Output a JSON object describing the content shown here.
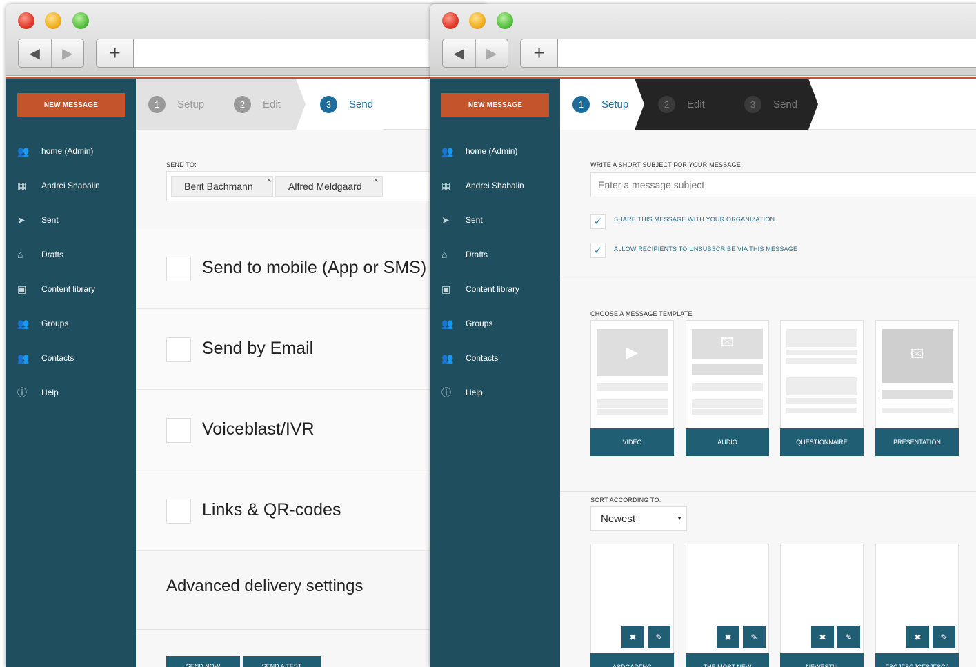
{
  "colors": {
    "sidebar_bg": "#1f4e5e",
    "accent_orange": "#c4542c",
    "primary_button": "#1f5e73",
    "active_step": "#1d6c9a",
    "inactive_step": "#9a9a9a",
    "dark_step_bar": "#242424"
  },
  "browser": {
    "back_icon": "back-arrow-icon",
    "forward_icon": "forward-arrow-icon",
    "new_tab_label": "+"
  },
  "sidebar": {
    "new_message_label": "NEW MESSAGE",
    "items": [
      {
        "label": "home (Admin)",
        "icon": "people-icon"
      },
      {
        "label": "Andrei Shabalin",
        "icon": "calendar-icon"
      },
      {
        "label": "Sent",
        "icon": "paper-plane-icon"
      },
      {
        "label": "Drafts",
        "icon": "inbox-icon"
      },
      {
        "label": "Content library",
        "icon": "library-icon"
      },
      {
        "label": "Groups",
        "icon": "people-icon"
      },
      {
        "label": "Contacts",
        "icon": "people-icon"
      },
      {
        "label": "Help",
        "icon": "info-icon"
      }
    ]
  },
  "steps": [
    {
      "num": "1",
      "label": "Setup"
    },
    {
      "num": "2",
      "label": "Edit"
    },
    {
      "num": "3",
      "label": "Send"
    }
  ],
  "send_page": {
    "active_step": "3",
    "send_to_label": "SEND TO:",
    "recipients": [
      "Berit Bachmann",
      "Alfred Meldgaard"
    ],
    "remove_icon_glyph": "×",
    "delivery_options": [
      "Send to mobile (App or SMS)",
      "Send by Email",
      "Voiceblast/IVR",
      "Links & QR-codes"
    ],
    "advanced_label": "Advanced delivery settings",
    "send_now_label": "SEND NOW",
    "send_test_label": "SEND A TEST"
  },
  "setup_page": {
    "active_step": "1",
    "subject_label": "WRITE A SHORT SUBJECT FOR YOUR MESSAGE",
    "subject_placeholder": "Enter a message subject",
    "share_label": "SHARE THIS MESSAGE WITH YOUR ORGANIZATION",
    "share_checked": true,
    "unsubscribe_label": "ALLOW RECIPIENTS TO UNSUBSCRIBE VIA THIS MESSAGE",
    "unsubscribe_checked": true,
    "check_glyph": "✓",
    "template_label": "CHOOSE A MESSAGE TEMPLATE",
    "templates": [
      {
        "label": "VIDEO",
        "icon": "play-icon"
      },
      {
        "label": "AUDIO",
        "icon": "image-icon"
      },
      {
        "label": "QUESTIONNAIRE",
        "icon": "text-lines-icon"
      },
      {
        "label": "PRESENTATION",
        "icon": "image-icon"
      }
    ],
    "sort_label": "SORT ACCORDING TO:",
    "sort_value": "Newest",
    "delete_glyph": "✖",
    "edit_glyph": "✎",
    "messages": [
      "ASDGADFHG",
      "THE MOST NEW",
      "NEWEST!!!",
      "FSGJFSGJGFSJFSGJ"
    ]
  }
}
